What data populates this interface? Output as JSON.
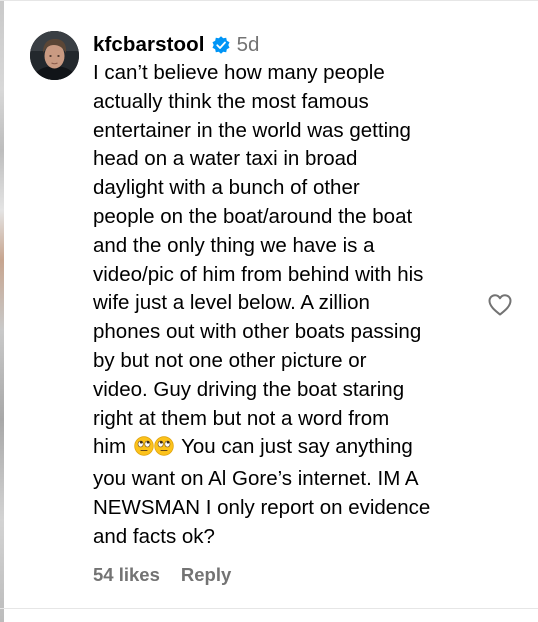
{
  "comment": {
    "username": "kfcbarstool",
    "verified_icon": "verified-badge-icon",
    "timestamp": "5d",
    "text_lines": [
      "I can’t believe how many people",
      "actually think the most famous",
      "entertainer in the world was getting",
      "head on a water taxi in broad",
      "daylight with a bunch of other",
      "people on the boat/around the boat",
      "and the only thing we have is a",
      "video/pic of him from behind with his",
      "wife just a level below. A zillion",
      "phones out with other boats passing",
      "by but not one other picture or",
      "video. Guy driving the boat staring",
      "right at them but not a word from",
      "You can just say anything",
      "you want on Al Gore’s internet. IM A",
      "NEWSMAN I only report on evidence",
      "and facts ok?"
    ],
    "line13_prefix": "him",
    "emoji": "face-with-rolling-eyes-emoji",
    "like_icon": "heart-outline-icon",
    "likes_label": "54 likes",
    "reply_label": "Reply",
    "accent_colors": {
      "verified_blue": "#0095f6",
      "secondary_text": "#737373"
    }
  }
}
